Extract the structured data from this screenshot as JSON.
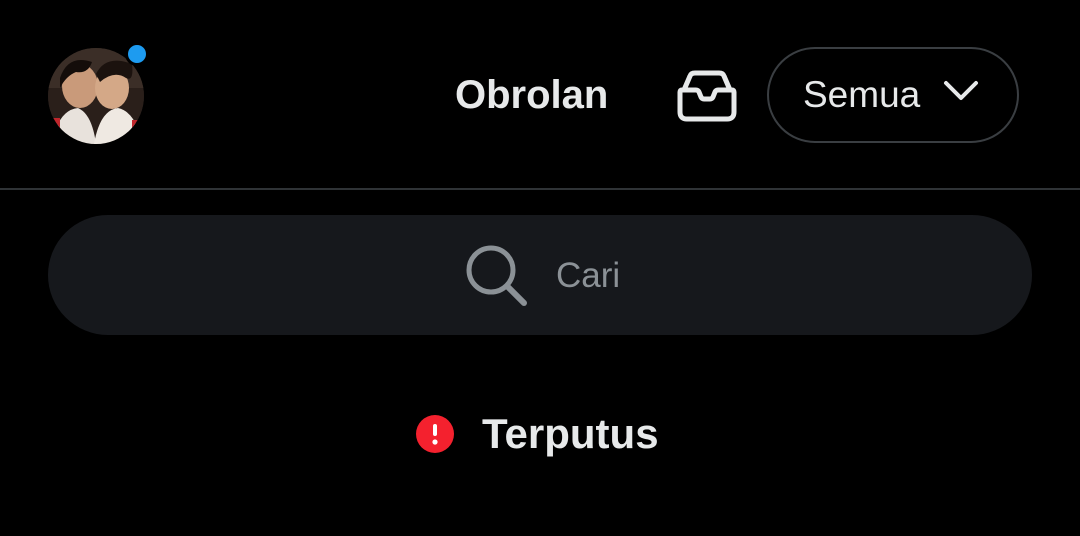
{
  "header": {
    "title": "Obrolan",
    "filter_label": "Semua",
    "notification_color": "#1d9bf0",
    "avatar_icon": "user-avatar",
    "inbox_icon": "inbox-tray-icon",
    "filter_icon": "chevron-down-icon"
  },
  "search": {
    "placeholder": "Cari",
    "value": "",
    "icon": "search-icon"
  },
  "status": {
    "text": "Terputus",
    "icon": "alert-icon",
    "color": "#f4212e"
  }
}
